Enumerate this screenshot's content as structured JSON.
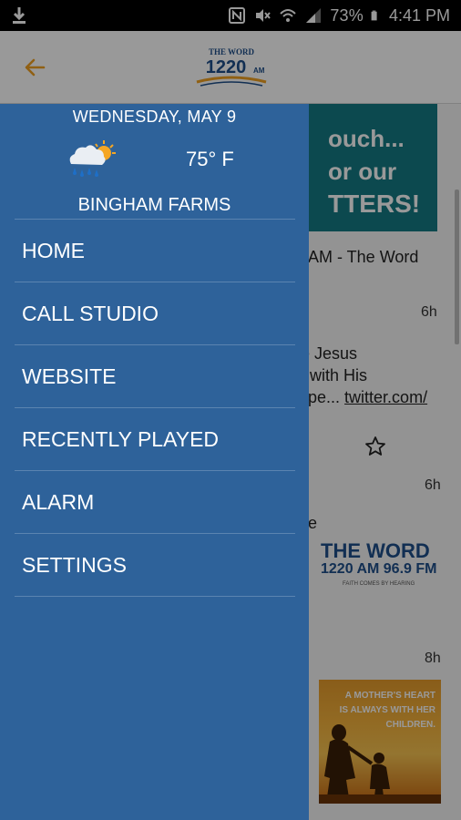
{
  "status_bar": {
    "battery_percent": "73%",
    "time": "4:41 PM",
    "icons": [
      "download-icon",
      "nfc-icon",
      "mute-icon",
      "wifi-icon",
      "signal-icon",
      "battery-icon"
    ]
  },
  "app_bar": {
    "back_icon": "arrow-back-icon",
    "logo_text_top": "THE WORD",
    "logo_text_freq": "1220",
    "logo_text_am": "AM"
  },
  "drawer": {
    "date": "WEDNESDAY, MAY 9",
    "weather_icon": "cloud-rain-sun-icon",
    "temperature": "75° F",
    "location": "BINGHAM FARMS",
    "menu_items": [
      {
        "label": "HOME"
      },
      {
        "label": "CALL STUDIO"
      },
      {
        "label": "WEBSITE"
      },
      {
        "label": "RECENTLY PLAYED"
      },
      {
        "label": "ALARM"
      },
      {
        "label": "SETTINGS"
      }
    ]
  },
  "background": {
    "promo_lines": [
      "ouch...",
      "or our",
      "TTERS!"
    ],
    "feed_header": "AM - The Word",
    "post1_time": "6h",
    "post1_lines": [
      "e Jesus",
      "with His",
      "pe..."
    ],
    "post1_link": "twitter.com/",
    "post2_time": "6h",
    "post2_fragment": "e",
    "word_logo_title": "THE WORD",
    "word_logo_freq": "1220 AM 96.9 FM",
    "word_logo_tagline": "FAITH COMES BY HEARING",
    "post3_time": "8h",
    "mother_image_text": "A MOTHER'S HEART IS ALWAYS WITH HER CHILDREN."
  },
  "colors": {
    "drawer_bg": "#2e629a",
    "accent_orange": "#f0a020",
    "promo_teal": "#147a84",
    "logo_blue": "#1e4f8a"
  }
}
